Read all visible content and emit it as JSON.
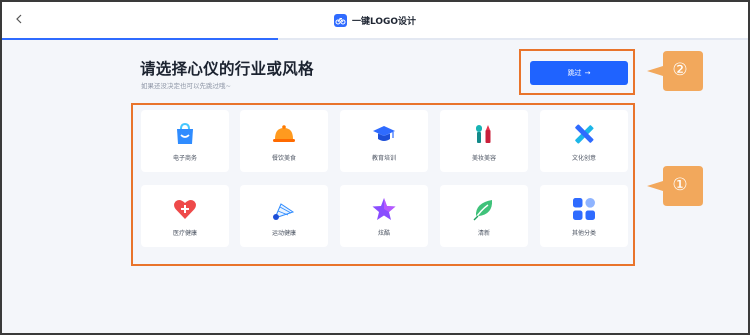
{
  "header": {
    "app_title": "一键LOGO设计",
    "back_icon": "chevron-left-icon",
    "logo_icon": "bike-logo-icon",
    "progress_fraction": 0.37
  },
  "page": {
    "heading": "请选择心仪的行业或风格",
    "subheading": "如果还没决定也可以先跳过哦~",
    "skip_label": "跳过",
    "skip_arrow": "→"
  },
  "categories": [
    {
      "label": "电子商务",
      "icon": "shopping-bag-icon"
    },
    {
      "label": "餐饮美食",
      "icon": "food-cloche-icon"
    },
    {
      "label": "教育培训",
      "icon": "graduation-cap-icon"
    },
    {
      "label": "美妆美容",
      "icon": "lipstick-icon"
    },
    {
      "label": "文化创意",
      "icon": "pen-ruler-icon"
    },
    {
      "label": "医疗健康",
      "icon": "heart-plus-icon"
    },
    {
      "label": "运动健康",
      "icon": "shuttlecock-icon"
    },
    {
      "label": "炫酷",
      "icon": "star-icon"
    },
    {
      "label": "清新",
      "icon": "leaf-icon"
    },
    {
      "label": "其他分类",
      "icon": "grid-squares-icon"
    }
  ],
  "annotations": {
    "callout_1": "①",
    "callout_2": "②"
  },
  "colors": {
    "accent": "#1f63ff",
    "annotation": "#e9742b",
    "callout_fill": "#f2a85c"
  }
}
